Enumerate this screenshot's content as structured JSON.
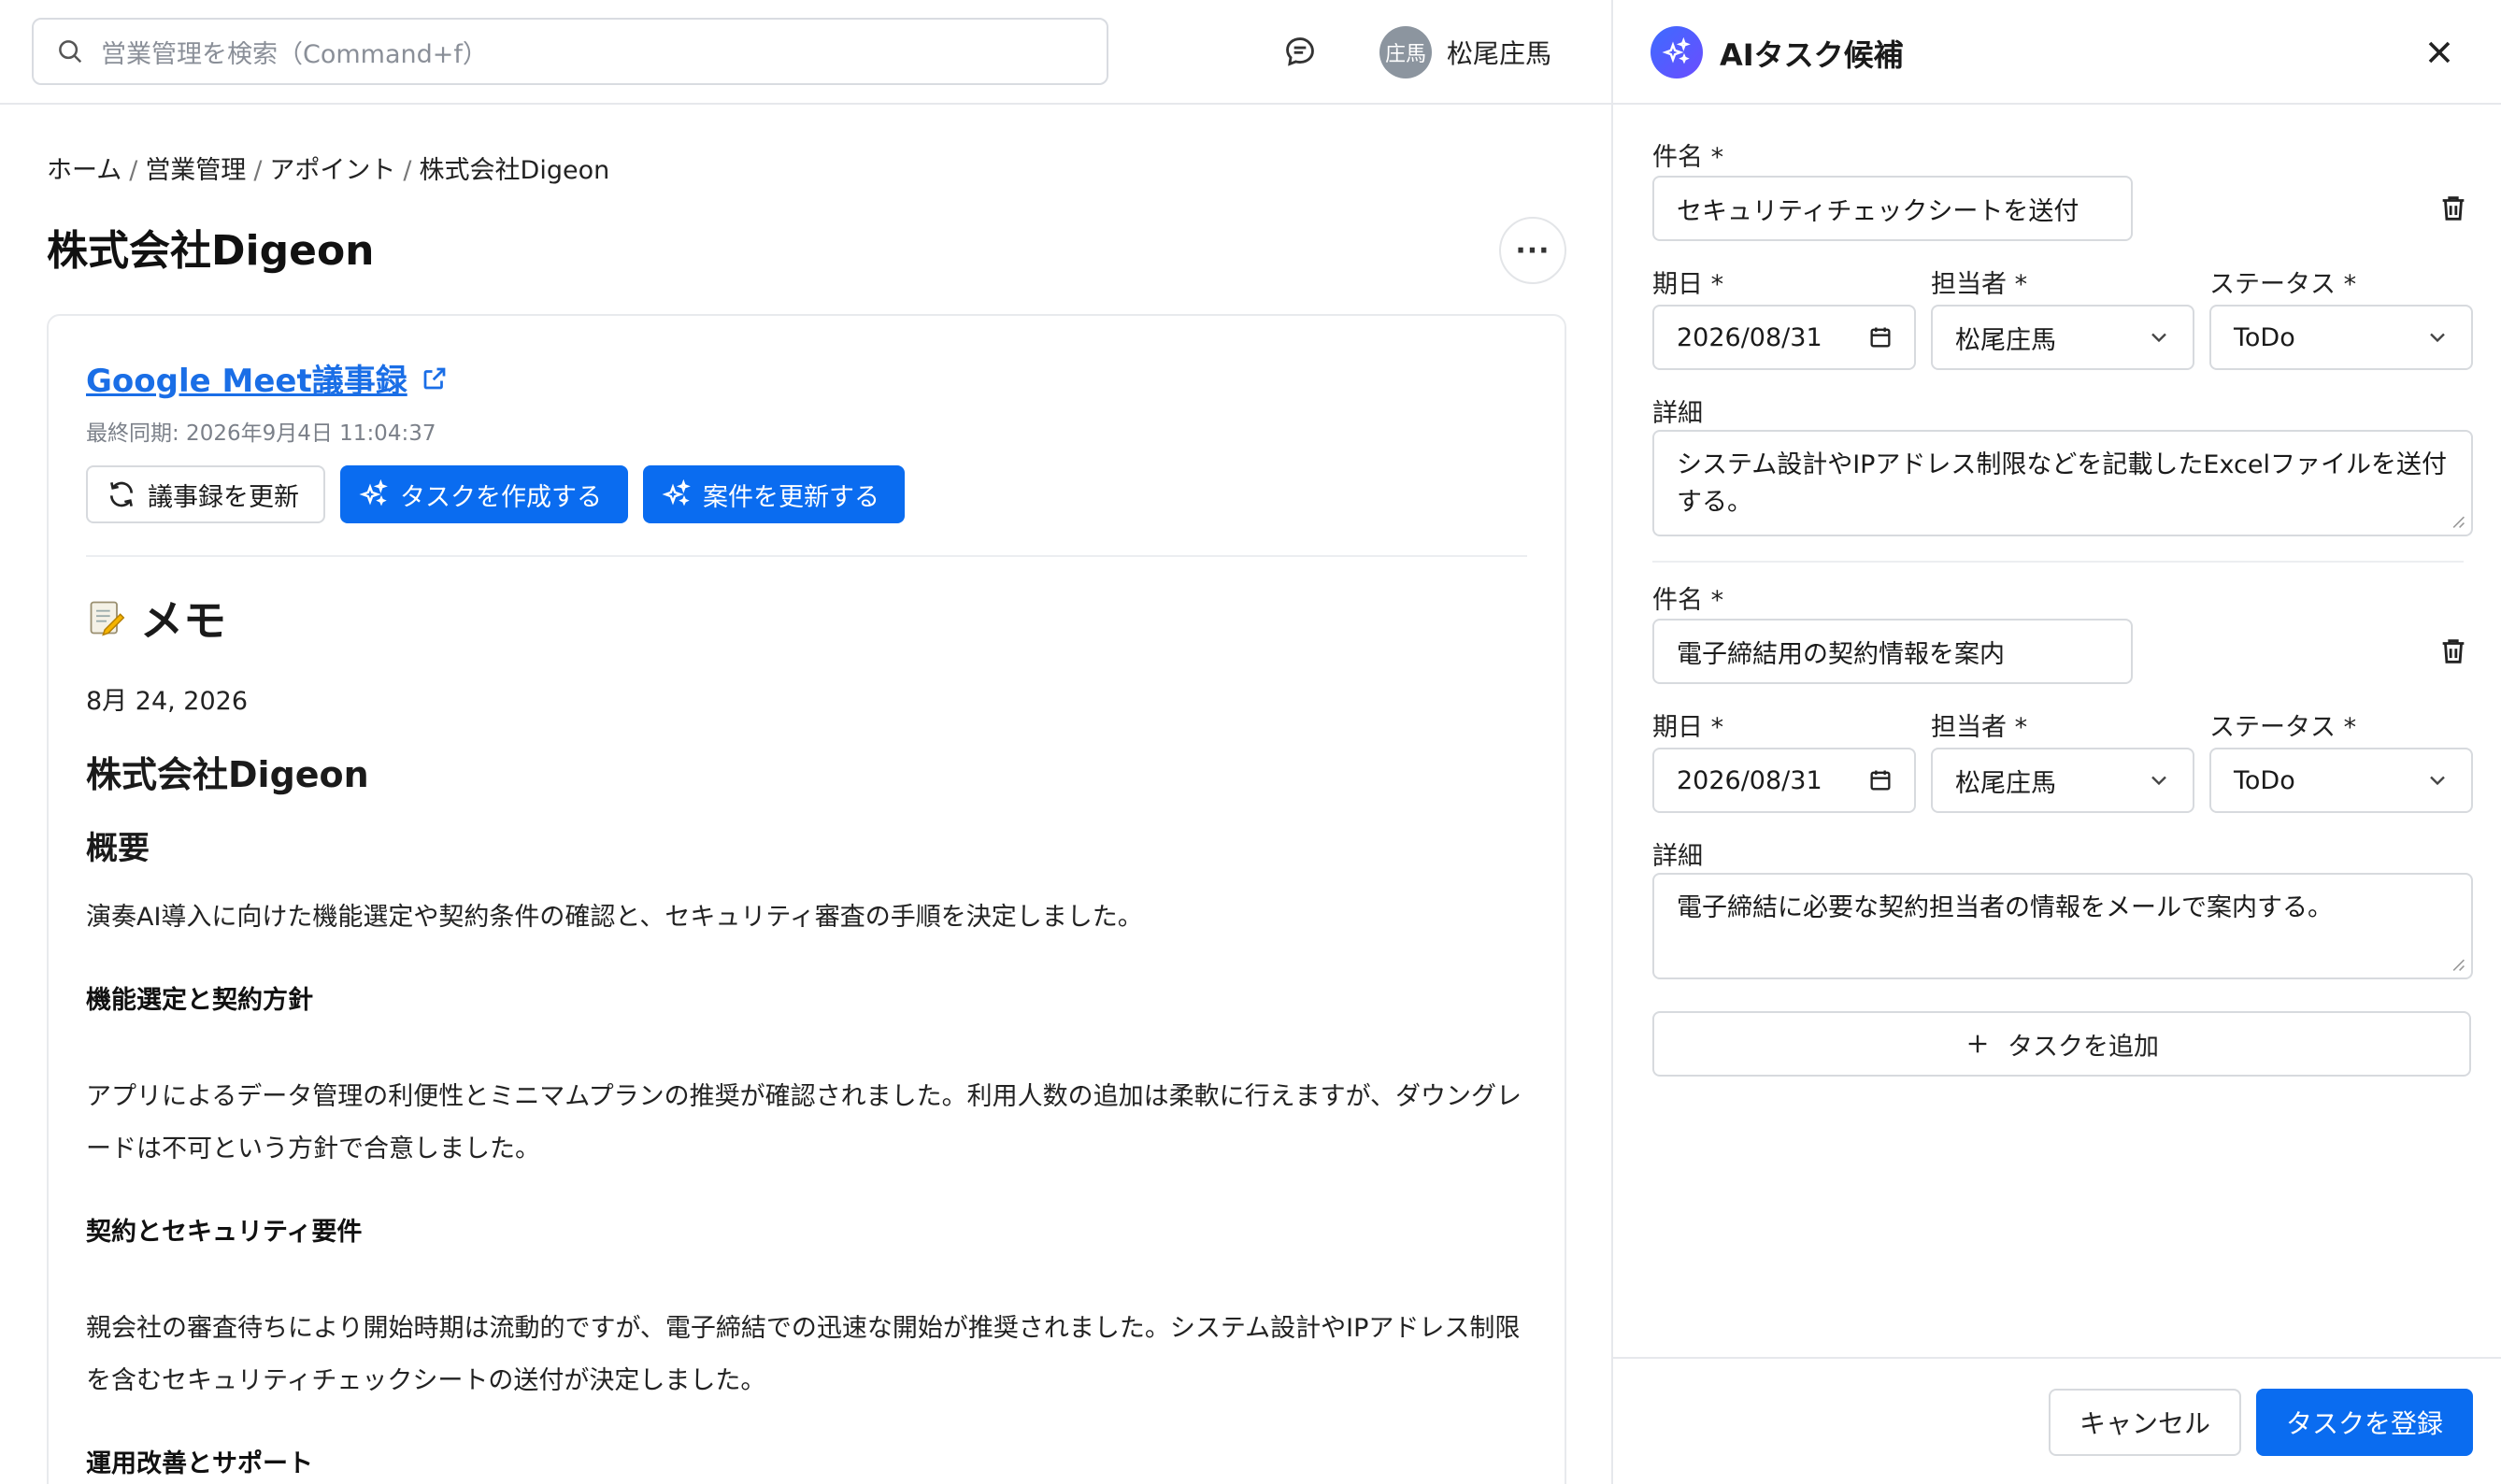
{
  "header": {
    "search_placeholder": "営業管理を検索（Command+f）",
    "avatar_text": "庄馬",
    "user_name": "松尾庄馬"
  },
  "breadcrumb": [
    "ホーム",
    "営業管理",
    "アポイント",
    "株式会社Digeon"
  ],
  "page": {
    "title": "株式会社Digeon",
    "more_label": "···"
  },
  "record": {
    "link_text": "Google Meet議事録",
    "last_sync": "最終同期: 2026年9月4日 11:04:37",
    "btn_refresh": "議事録を更新",
    "btn_create_task": "タスクを作成する",
    "btn_update_case": "案件を更新する"
  },
  "memo": {
    "heading": "メモ",
    "date": "8月 24, 2026",
    "company": "株式会社Digeon",
    "summary_heading": "概要",
    "summary": "演奏AI導入に向けた機能選定や契約条件の確認と、セキュリティ審査の手順を決定しました。",
    "sec1_heading": "機能選定と契約方針",
    "sec1_text": "アプリによるデータ管理の利便性とミニマムプランの推奨が確認されました。利用人数の追加は柔軟に行えますが、ダウングレードは不可という方針で合意しました。",
    "sec2_heading": "契約とセキュリティ要件",
    "sec2_text": "親会社の審査待ちにより開始時期は流動的ですが、電子締結での迅速な開始が推奨されました。システム設計やIPアドレス制限を含むセキュリティチェックシートの送付が決定しました。",
    "sec3_heading": "運用改善とサポート"
  },
  "panel": {
    "title": "AIタスク候補",
    "label_subject": "件名 *",
    "label_due": "期日 *",
    "label_owner": "担当者 *",
    "label_status": "ステータス *",
    "label_detail": "詳細",
    "tasks": [
      {
        "subject": "セキュリティチェックシートを送付",
        "due": "2026/08/31",
        "owner": "松尾庄馬",
        "status": "ToDo",
        "detail": "システム設計やIPアドレス制限などを記載したExcelファイルを送付する。"
      },
      {
        "subject": "電子締結用の契約情報を案内",
        "due": "2026/08/31",
        "owner": "松尾庄馬",
        "status": "ToDo",
        "detail": "電子締結に必要な契約担当者の情報をメールで案内する。"
      }
    ],
    "add_task": "タスクを追加",
    "cancel": "キャンセル",
    "submit": "タスクを登録"
  },
  "colors": {
    "primary": "#0a6cf0",
    "link": "#1a6ee6",
    "border": "#d7dade"
  }
}
